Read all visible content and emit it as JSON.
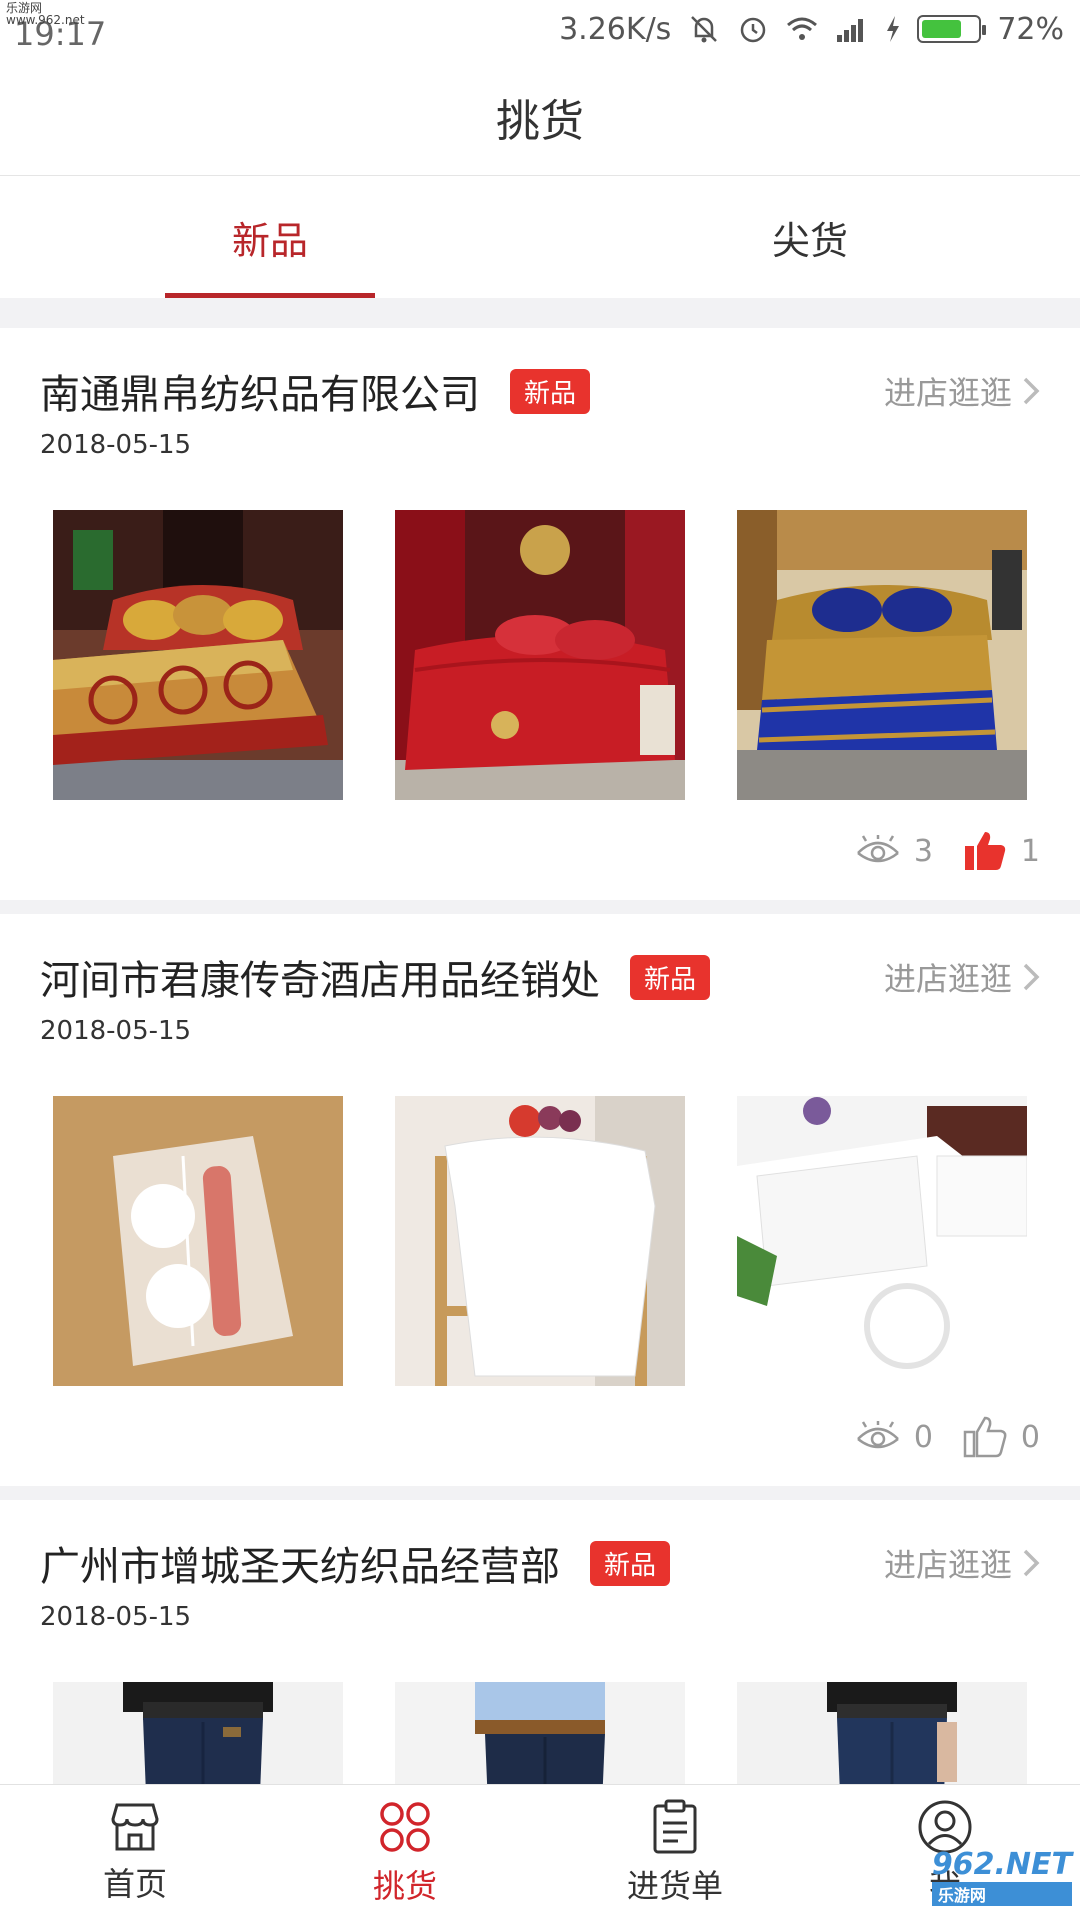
{
  "statusbar": {
    "watermark": "乐游网 www.962.net",
    "time": "19:17",
    "speed": "3.26K/s",
    "battery": "72%",
    "battery_level": 0.72
  },
  "title": "挑货",
  "tabs": [
    {
      "label": "新品"
    },
    {
      "label": "尖货"
    }
  ],
  "stores": [
    {
      "name": "南通鼎帛纺织品有限公司",
      "badge": "新品",
      "visit": "进店逛逛",
      "date": "2018-05-15",
      "views": "3",
      "likes": "1",
      "liked": true
    },
    {
      "name": "河间市君康传奇酒店用品经销处",
      "badge": "新品",
      "visit": "进店逛逛",
      "date": "2018-05-15",
      "views": "0",
      "likes": "0",
      "liked": false
    },
    {
      "name": "广州市增城圣天纺织品经营部",
      "badge": "新品",
      "visit": "进店逛逛",
      "date": "2018-05-15"
    }
  ],
  "nav": [
    {
      "label": "首页",
      "icon": "shop-icon"
    },
    {
      "label": "挑货",
      "icon": "grid-icon"
    },
    {
      "label": "进货单",
      "icon": "clipboard-icon"
    },
    {
      "label": "我",
      "icon": "user-icon"
    }
  ],
  "watermark_bottom": "962.NET",
  "watermark_bottom_sub": "乐游网",
  "colors": {
    "accent": "#b8262a",
    "badge": "#e8332d"
  }
}
